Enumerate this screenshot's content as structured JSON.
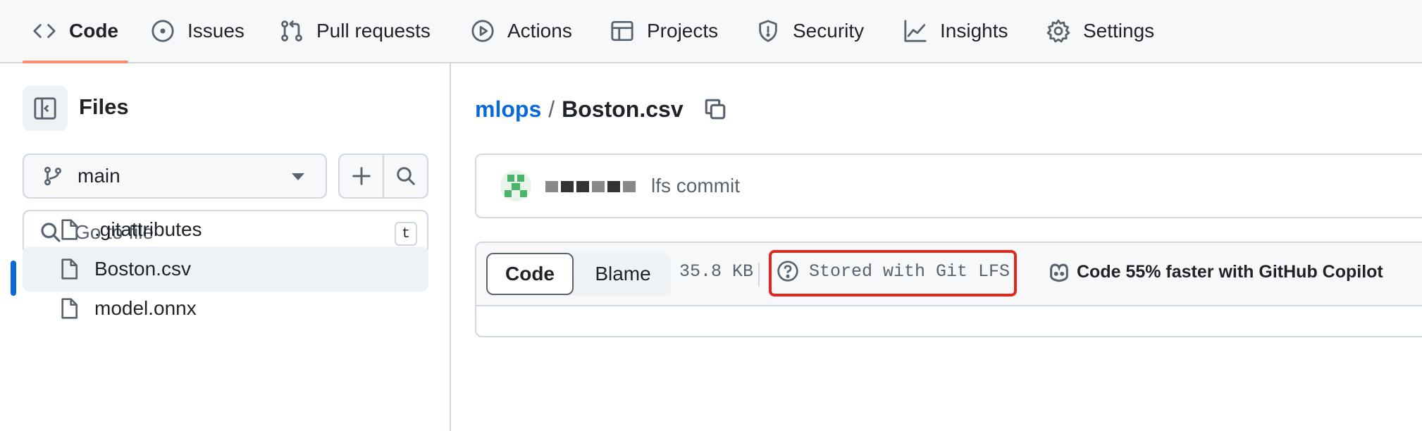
{
  "nav": {
    "tabs": [
      {
        "label": "Code",
        "icon": "code-icon",
        "active": true
      },
      {
        "label": "Issues",
        "icon": "issue-circle-icon"
      },
      {
        "label": "Pull requests",
        "icon": "pull-request-icon"
      },
      {
        "label": "Actions",
        "icon": "play-circle-icon"
      },
      {
        "label": "Projects",
        "icon": "table-icon"
      },
      {
        "label": "Security",
        "icon": "shield-icon"
      },
      {
        "label": "Insights",
        "icon": "graph-icon"
      },
      {
        "label": "Settings",
        "icon": "gear-icon"
      }
    ]
  },
  "sidebar": {
    "title": "Files",
    "branch": "main",
    "search": {
      "placeholder": "Go to file",
      "shortcut": "t"
    },
    "files": [
      {
        "name": ".gitattributes",
        "selected": false
      },
      {
        "name": "Boston.csv",
        "selected": true
      },
      {
        "name": "model.onnx",
        "selected": false
      }
    ]
  },
  "main": {
    "breadcrumb": {
      "repo": "mlops",
      "separator": "/",
      "file": "Boston.csv"
    },
    "commit": {
      "message": "lfs commit"
    },
    "file_header": {
      "code_label": "Code",
      "blame_label": "Blame",
      "size": "35.8 KB",
      "lfs_label": "Stored with Git LFS",
      "copilot_label": "Code 55% faster with GitHub Copilot"
    }
  },
  "colors": {
    "accent": "#0969da",
    "tab_underline": "#fd8c73",
    "highlight": "#e3261b"
  }
}
